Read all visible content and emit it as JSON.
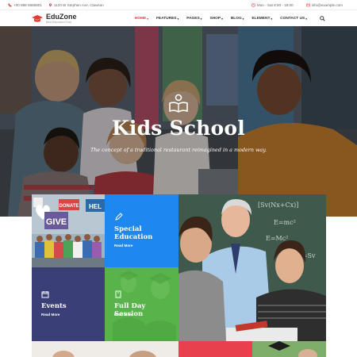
{
  "topbar": {
    "phone": "+00 888 9666801",
    "address": "1120 W Stephen Ave, Clawson",
    "hours": "Mon - Sat 8:00 - 18:00",
    "email": "info@example.com"
  },
  "brand": {
    "name": "EduZone",
    "tagline": "Best Education Envy"
  },
  "nav": {
    "items": [
      {
        "label": "HOME",
        "active": true
      },
      {
        "label": "FEATURES",
        "active": false
      },
      {
        "label": "PAGES",
        "active": false
      },
      {
        "label": "SHOP",
        "active": false
      },
      {
        "label": "BLOG",
        "active": false
      },
      {
        "label": "ELEMENT",
        "active": false
      },
      {
        "label": "CONTACT US",
        "active": false
      }
    ]
  },
  "hero": {
    "title": "Kids School",
    "subtitle": "The concept of a traditional restaurant reimagined in a modern way."
  },
  "tiles": {
    "special": {
      "title": "Special Education",
      "link": "Read More",
      "color": "#1e88f0"
    },
    "events": {
      "title": "Events",
      "link": "Read More",
      "color": "#3a3f78"
    },
    "fullday": {
      "title": "Full Day Session",
      "link": "Read More",
      "color": "#57b34a"
    }
  },
  "board": {
    "line1": "[Sv(Nx+Cx)]",
    "line2": "E=mc²",
    "line3": "E=Mc²",
    "line4": "V=Sv"
  },
  "signs": {
    "donate": "DONATE",
    "give": "GIVE",
    "help": "HEL"
  },
  "colors": {
    "accent": "#e53935",
    "blue": "#1e88f0",
    "navy": "#3a3f78",
    "green": "#57b34a"
  }
}
